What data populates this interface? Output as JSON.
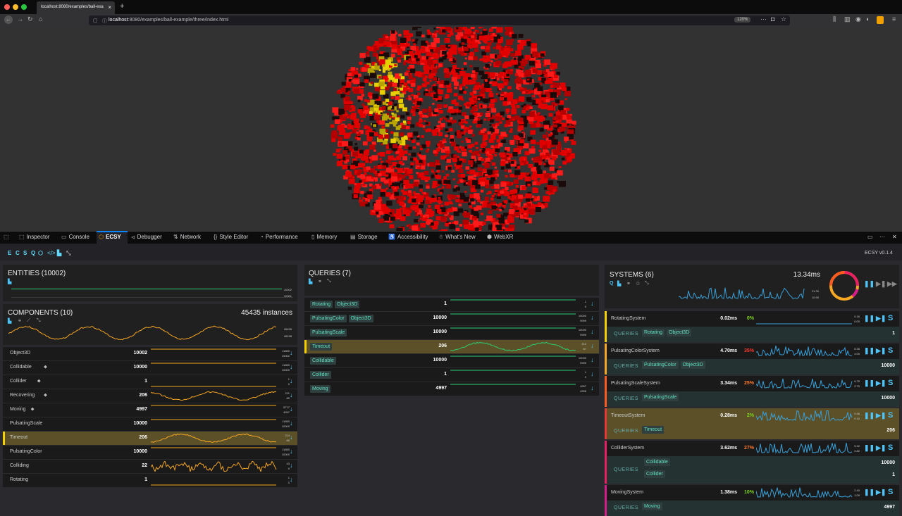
{
  "browser": {
    "tab_title": "localhost:8080/examples/ball-exa",
    "url_host": "localhost",
    "url_rest": ":8080/examples/ball-example/three/index.html",
    "zoom": "120%"
  },
  "devtools": {
    "tabs": [
      "Inspector",
      "Console",
      "ECSY",
      "Debugger",
      "Network",
      "Style Editor",
      "Performance",
      "Memory",
      "Storage",
      "Accessibility",
      "What's New",
      "WebXR"
    ],
    "active_tab": "ECSY"
  },
  "ecsy": {
    "letters": [
      "E",
      "C",
      "S",
      "Q"
    ],
    "version": "ECSY v0.1.4"
  },
  "entities": {
    "title": "ENTITIES (10002)",
    "max": "10002",
    "min": "10001"
  },
  "components": {
    "title": "COMPONENTS (10)",
    "instances": "45435 instances",
    "spark_max": "45435",
    "spark_min": "45198",
    "rows": [
      {
        "name": "Object3D",
        "tag": false,
        "value": "10002",
        "hi": "11850",
        "lo": "10002",
        "trend": "flat"
      },
      {
        "name": "Collidable",
        "tag": true,
        "value": "10000",
        "hi": "11850",
        "lo": "10000",
        "trend": "flat"
      },
      {
        "name": "Collider",
        "tag": true,
        "value": "1",
        "hi": "1",
        "lo": "0",
        "trend": "flatlow"
      },
      {
        "name": "Recovering",
        "tag": true,
        "value": "206",
        "hi": "211",
        "lo": "80",
        "trend": "wave"
      },
      {
        "name": "Moving",
        "tag": true,
        "value": "4997",
        "hi": "5717",
        "lo": "4997",
        "trend": "flat"
      },
      {
        "name": "PulsatingScale",
        "tag": false,
        "value": "10000",
        "hi": "11850",
        "lo": "10000",
        "trend": "flat"
      },
      {
        "name": "Timeout",
        "tag": false,
        "value": "206",
        "hi": "214",
        "lo": "80",
        "trend": "wave",
        "selected": true
      },
      {
        "name": "PulsatingColor",
        "tag": false,
        "value": "10000",
        "hi": "11850",
        "lo": "10000",
        "trend": "flat"
      },
      {
        "name": "Colliding",
        "tag": false,
        "value": "22",
        "hi": "43",
        "lo": "0",
        "trend": "noise"
      },
      {
        "name": "Rotating",
        "tag": false,
        "value": "1",
        "hi": "1",
        "lo": "0",
        "trend": "flatlow"
      }
    ]
  },
  "queries": {
    "title": "QUERIES (7)",
    "rows": [
      {
        "tags": [
          "Rotating",
          "Object3D"
        ],
        "value": "1",
        "hi": "1",
        "lo": "0",
        "trend": "flat"
      },
      {
        "tags": [
          "PulsatingColor",
          "Object3D"
        ],
        "value": "10000",
        "hi": "10000",
        "lo": "9999",
        "trend": "flat"
      },
      {
        "tags": [
          "PulsatingScale"
        ],
        "value": "10000",
        "hi": "10000",
        "lo": "9999",
        "trend": "flat"
      },
      {
        "tags": [
          "Timeout"
        ],
        "value": "206",
        "hi": "210",
        "lo": "87",
        "trend": "wave",
        "selected": true
      },
      {
        "tags": [
          "Collidable"
        ],
        "value": "10000",
        "hi": "10000",
        "lo": "9999",
        "trend": "flat"
      },
      {
        "tags": [
          "Collider"
        ],
        "value": "1",
        "hi": "1",
        "lo": "0",
        "trend": "flat"
      },
      {
        "tags": [
          "Moving"
        ],
        "value": "4997",
        "hi": "4997",
        "lo": "4996",
        "trend": "flat"
      }
    ]
  },
  "systems": {
    "title": "SYSTEMS (6)",
    "total": "13.34ms",
    "spark_max": "21.30",
    "spark_min": "10.90",
    "queries_label": "QUERIES",
    "rows": [
      {
        "name": "RotatingSystem",
        "ms": "0.02ms",
        "pct": "0%",
        "pct_color": "#7ed321",
        "bar": "#f5d000",
        "hi": "0.16",
        "lo": "0.00",
        "queries": [
          {
            "tags": [
              "Rotating",
              "Object3D"
            ],
            "count": "1"
          }
        ]
      },
      {
        "name": "PulsatingColorSystem",
        "ms": "4.70ms",
        "pct": "35%",
        "pct_color": "#ff3b30",
        "bar": "#f5a623",
        "hi": "8.36",
        "lo": "4.00",
        "queries": [
          {
            "tags": [
              "PulsatingColor",
              "Object3D"
            ],
            "count": "10000"
          }
        ]
      },
      {
        "name": "PulsatingScaleSystem",
        "ms": "3.34ms",
        "pct": "25%",
        "pct_color": "#ff7a30",
        "bar": "#ff5a1f",
        "hi": "6.75",
        "lo": "2.70",
        "queries": [
          {
            "tags": [
              "PulsatingScale"
            ],
            "count": "10000"
          }
        ]
      },
      {
        "name": "TimeoutSystem",
        "ms": "0.28ms",
        "pct": "2%",
        "pct_color": "#7ed321",
        "bar": "#e53935",
        "hi": "0.48",
        "lo": "0.10",
        "selected": true,
        "queries": [
          {
            "tags": [
              "Timeout"
            ],
            "count": "206"
          }
        ]
      },
      {
        "name": "ColliderSystem",
        "ms": "3.62ms",
        "pct": "27%",
        "pct_color": "#ff7a30",
        "bar": "#e91e63",
        "hi": "5.32",
        "lo": "2.82",
        "queries": [
          {
            "tags": [
              "Collidable"
            ],
            "count": "10000"
          },
          {
            "tags": [
              "Collider"
            ],
            "count": "1"
          }
        ]
      },
      {
        "name": "MovingSystem",
        "ms": "1.38ms",
        "pct": "10%",
        "pct_color": "#7ed321",
        "bar": "#d81b8a",
        "hi": "2.40",
        "lo": "1.09",
        "queries": [
          {
            "tags": [
              "Moving"
            ],
            "count": "4997"
          }
        ]
      }
    ]
  },
  "colors": {
    "accent": "#4fc3f7",
    "teal": "#5fe0c0",
    "chart_orange": "#f5a623",
    "chart_blue": "#3aa0d8",
    "chart_green": "#2ecc71"
  }
}
